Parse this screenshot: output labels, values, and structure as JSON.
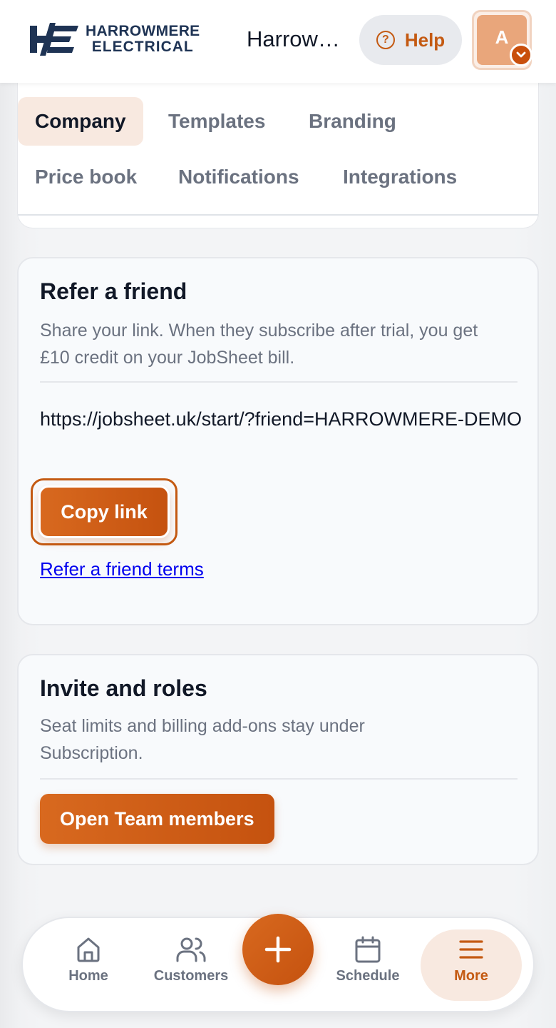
{
  "header": {
    "logo_line1": "HARROWMERE",
    "logo_line2": "ELECTRICAL",
    "company_name": "Harrowmere Electrical",
    "help_label": "Help",
    "avatar_initial": "A"
  },
  "tabs": [
    {
      "label": "Company",
      "active": true
    },
    {
      "label": "Templates",
      "active": false
    },
    {
      "label": "Branding",
      "active": false
    },
    {
      "label": "Price book",
      "active": false
    },
    {
      "label": "Notifications",
      "active": false
    },
    {
      "label": "Integrations",
      "active": false
    }
  ],
  "refer": {
    "title": "Refer a friend",
    "description": "Share your link. When they subscribe after trial, you get £10 credit on your JobSheet bill.",
    "link": "https://jobsheet.uk/start/?friend=HARROWMERE-DEMO",
    "copy_label": "Copy link",
    "terms_label": "Refer a friend terms"
  },
  "invite": {
    "title": "Invite and roles",
    "description": "Seat limits and billing add-ons stay under Subscription.",
    "button_label": "Open Team members"
  },
  "bottom_nav": [
    {
      "label": "Home",
      "icon": "home-icon"
    },
    {
      "label": "Customers",
      "icon": "users-icon"
    },
    {
      "label": "Schedule",
      "icon": "calendar-icon"
    },
    {
      "label": "More",
      "icon": "menu-icon",
      "active": true
    }
  ],
  "colors": {
    "accent": "#c5520f",
    "navy": "#1e3354",
    "active_tab_bg": "#f8e9e0"
  }
}
